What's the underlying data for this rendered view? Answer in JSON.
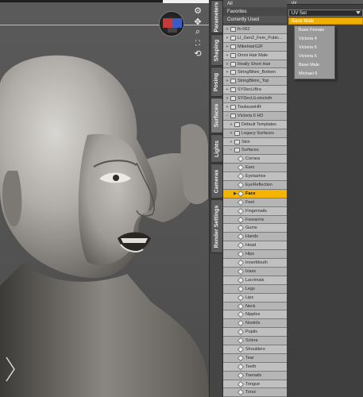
{
  "side_tabs": [
    "Parameters",
    "Shaping",
    "Posing",
    "Surfaces",
    "Lights",
    "Cameras",
    "Render Settings"
  ],
  "active_tab": "Surfaces",
  "filters": [
    "All",
    "Favorites",
    "Currently Used"
  ],
  "tree": [
    {
      "label": "fn-062",
      "indent": 0,
      "expander": "+",
      "icon": "figure"
    },
    {
      "label": "LI_Gen2_Fem_Pubic...",
      "indent": 0,
      "expander": "+",
      "icon": "figure"
    },
    {
      "label": "MikeHairG2F",
      "indent": 0,
      "expander": "+",
      "icon": "figure"
    },
    {
      "label": "Omni Hair Male",
      "indent": 0,
      "expander": "+",
      "icon": "figure"
    },
    {
      "label": "Really Short Hair",
      "indent": 0,
      "expander": "+",
      "icon": "figure"
    },
    {
      "label": "StringBikini_Bottom",
      "indent": 0,
      "expander": "+",
      "icon": "figure"
    },
    {
      "label": "StringBikini_Top",
      "indent": 0,
      "expander": "+",
      "icon": "figure"
    },
    {
      "label": "SYDecLiBra",
      "indent": 0,
      "expander": "+",
      "icon": "figure"
    },
    {
      "label": "SYDecLiLoincloth",
      "indent": 0,
      "expander": "+",
      "icon": "figure"
    },
    {
      "label": "ToulouseHR",
      "indent": 0,
      "expander": "+",
      "icon": "figure"
    },
    {
      "label": "Victoria 6 HD",
      "indent": 0,
      "expander": "−",
      "icon": "figure"
    },
    {
      "label": "Default Templates",
      "indent": 1,
      "expander": "+",
      "icon": "folder"
    },
    {
      "label": "Legacy Surfaces",
      "indent": 1,
      "expander": "+",
      "icon": "folder"
    },
    {
      "label": "Skin",
      "indent": 1,
      "expander": "+",
      "icon": "folder"
    },
    {
      "label": "Surfaces",
      "indent": 1,
      "expander": "−",
      "icon": "folder"
    },
    {
      "label": "Cornea",
      "indent": 2,
      "expander": "",
      "icon": "material"
    },
    {
      "label": "Ears",
      "indent": 2,
      "expander": "",
      "icon": "material"
    },
    {
      "label": "Eyelashes",
      "indent": 2,
      "expander": "",
      "icon": "material"
    },
    {
      "label": "EyeReflection",
      "indent": 2,
      "expander": "",
      "icon": "material"
    },
    {
      "label": "Face",
      "indent": 2,
      "expander": "▶",
      "icon": "material",
      "selected": true
    },
    {
      "label": "Feet",
      "indent": 2,
      "expander": "",
      "icon": "material"
    },
    {
      "label": "Fingernails",
      "indent": 2,
      "expander": "",
      "icon": "material"
    },
    {
      "label": "Forearms",
      "indent": 2,
      "expander": "",
      "icon": "material"
    },
    {
      "label": "Gums",
      "indent": 2,
      "expander": "",
      "icon": "material"
    },
    {
      "label": "Hands",
      "indent": 2,
      "expander": "",
      "icon": "material"
    },
    {
      "label": "Head",
      "indent": 2,
      "expander": "",
      "icon": "material"
    },
    {
      "label": "Hips",
      "indent": 2,
      "expander": "",
      "icon": "material"
    },
    {
      "label": "InnerMouth",
      "indent": 2,
      "expander": "",
      "icon": "material"
    },
    {
      "label": "Irises",
      "indent": 2,
      "expander": "",
      "icon": "material"
    },
    {
      "label": "Lacrimals",
      "indent": 2,
      "expander": "",
      "icon": "material"
    },
    {
      "label": "Legs",
      "indent": 2,
      "expander": "",
      "icon": "material"
    },
    {
      "label": "Lips",
      "indent": 2,
      "expander": "",
      "icon": "material"
    },
    {
      "label": "Neck",
      "indent": 2,
      "expander": "",
      "icon": "material"
    },
    {
      "label": "Nipples",
      "indent": 2,
      "expander": "",
      "icon": "material"
    },
    {
      "label": "Nostrils",
      "indent": 2,
      "expander": "",
      "icon": "material"
    },
    {
      "label": "Pupils",
      "indent": 2,
      "expander": "",
      "icon": "material"
    },
    {
      "label": "Sclera",
      "indent": 2,
      "expander": "",
      "icon": "material"
    },
    {
      "label": "Shoulders",
      "indent": 2,
      "expander": "",
      "icon": "material"
    },
    {
      "label": "Tear",
      "indent": 2,
      "expander": "",
      "icon": "material"
    },
    {
      "label": "Teeth",
      "indent": 2,
      "expander": "",
      "icon": "material"
    },
    {
      "label": "Toenails",
      "indent": 2,
      "expander": "",
      "icon": "material"
    },
    {
      "label": "Tongue",
      "indent": 2,
      "expander": "",
      "icon": "material"
    },
    {
      "label": "Torso",
      "indent": 2,
      "expander": "",
      "icon": "material"
    }
  ],
  "props": {
    "uv_label": "uv",
    "uv_set_label": "UV Set",
    "uv_selected": "Base Male",
    "uv_options": [
      "Base Female",
      "Victoria 4",
      "Victoria 6",
      "Victoria 5",
      "Base Male",
      "Michael 6"
    ]
  },
  "viewport_tools": [
    "view-cube-icon",
    "move-icon",
    "zoom-icon",
    "frame-icon",
    "rotate-icon"
  ]
}
